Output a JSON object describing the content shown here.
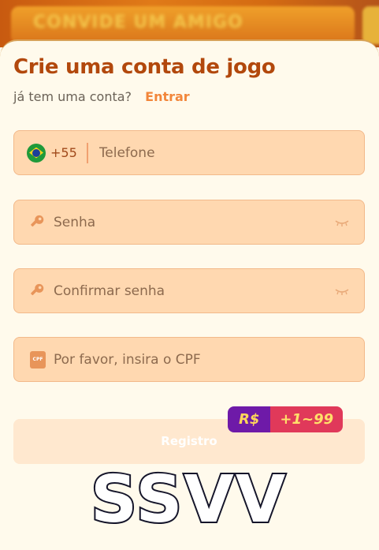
{
  "background": {
    "banner_text": "CONVIDE UM AMIGO"
  },
  "header": {
    "title": "Crie uma conta de jogo",
    "subtitle": "já tem uma conta?",
    "login_link": "Entrar"
  },
  "form": {
    "phone": {
      "country_flag": "brazil-flag-icon",
      "dial_code": "+55",
      "placeholder": "Telefone",
      "value": ""
    },
    "password": {
      "icon": "key-icon",
      "placeholder": "Senha",
      "value": "",
      "toggle_icon": "eye-closed-icon"
    },
    "confirm_password": {
      "icon": "key-icon",
      "placeholder": "Confirmar senha",
      "value": "",
      "toggle_icon": "eye-closed-icon"
    },
    "cpf": {
      "icon": "cpf-card-icon",
      "icon_text": "CPF",
      "placeholder": "Por favor, insira o CPF",
      "value": ""
    }
  },
  "register": {
    "label": "Registro",
    "bonus_currency": "R$",
    "bonus_value": "+1~99"
  },
  "watermark": "SSVV",
  "colors": {
    "title": "#b2480c",
    "accent": "#f2863a",
    "field_bg": "#ffd8b0",
    "button_bg": "#ffe8cf",
    "page_bg": "#fffaec"
  }
}
